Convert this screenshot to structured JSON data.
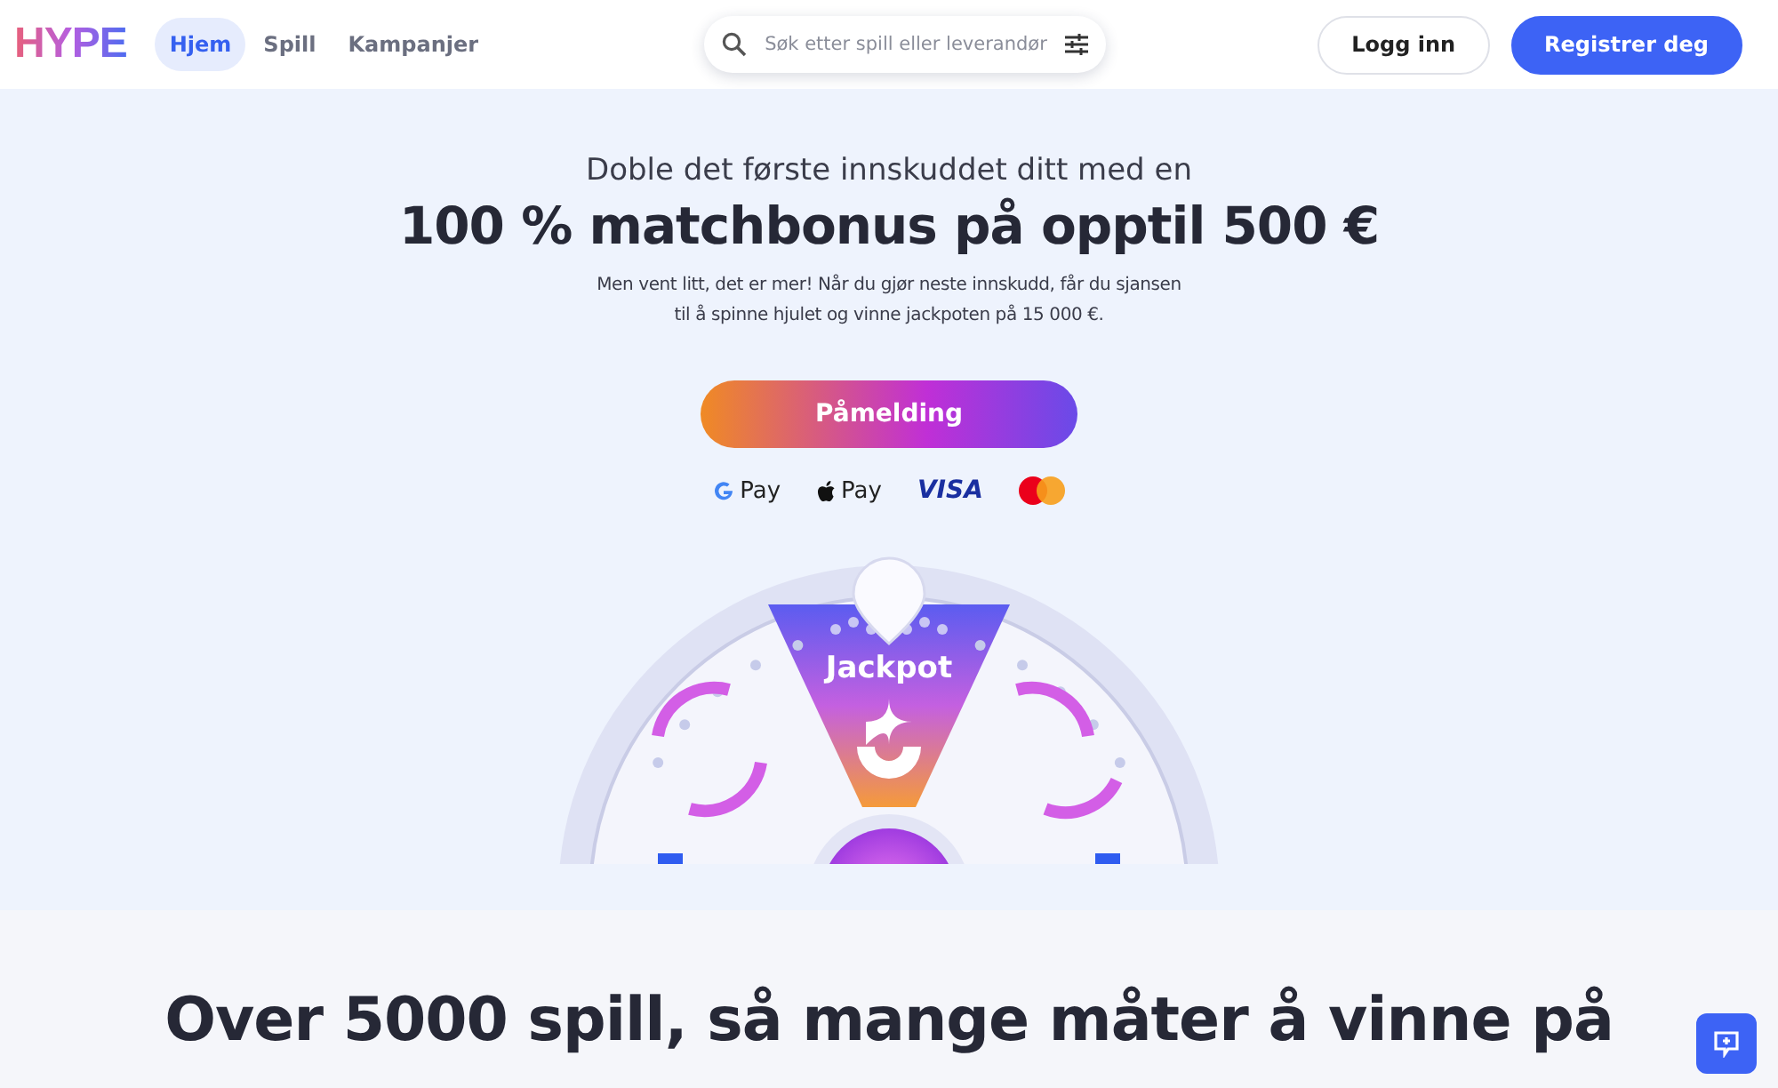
{
  "header": {
    "logo": "HYPE",
    "nav": [
      {
        "label": "Hjem",
        "selected": true
      },
      {
        "label": "Spill",
        "selected": false
      },
      {
        "label": "Kampanjer",
        "selected": false
      }
    ],
    "search": {
      "placeholder": "Søk etter spill eller leverandør"
    },
    "login": "Logg inn",
    "register": "Registrer deg"
  },
  "hero": {
    "kicker": "Doble det første innskuddet ditt med en",
    "headline": "100 % matchbonus på opptil 500 €",
    "body": "Men vent litt, det er mer! Når du gjør neste innskudd, får du sjansen til å spinne hjulet og vinne jackpoten på 15 000 €.",
    "cta": "Påmelding",
    "payments": [
      {
        "kind": "google",
        "label": "Pay"
      },
      {
        "kind": "apple",
        "label": "Pay"
      },
      {
        "kind": "visa",
        "label": "VISA"
      },
      {
        "kind": "mastercard"
      }
    ],
    "wheel": {
      "label": "Jackpot"
    }
  },
  "games": {
    "headline": "Over 5000 spill, så mange måter å vinne på"
  }
}
